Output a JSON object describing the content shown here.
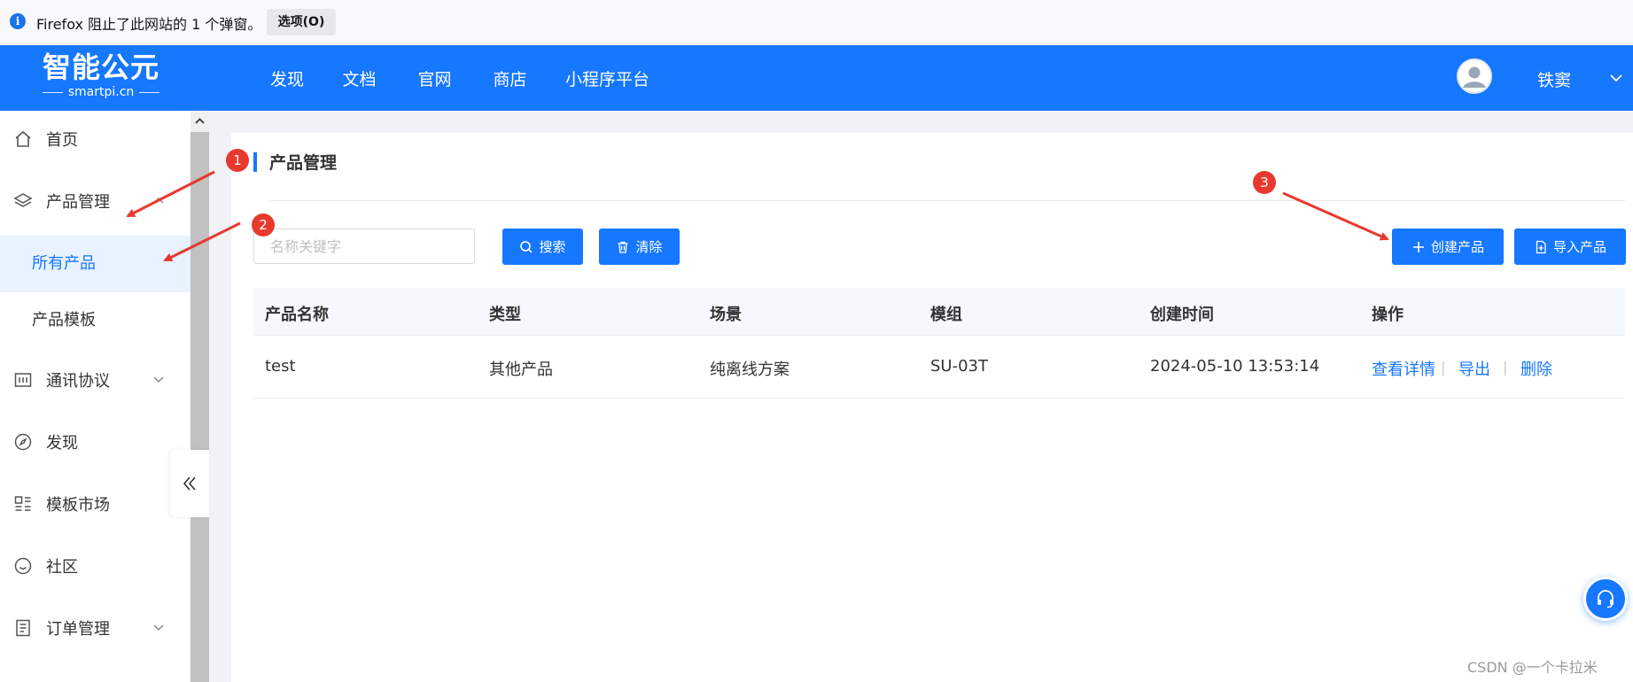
{
  "browser_notice": {
    "icon": "info-icon",
    "text": "Firefox 阻止了此网站的 1 个弹窗。",
    "options_button": "选项(O)"
  },
  "header": {
    "logo_main": "智能公元",
    "logo_sub": "smartpi.cn",
    "nav": [
      "发现",
      "文档",
      "官网",
      "商店",
      "小程序平台"
    ],
    "username": "铁窦",
    "brand_color": "#1677ff"
  },
  "sidebar": {
    "items": [
      {
        "label": "首页",
        "icon": "home-icon"
      },
      {
        "label": "产品管理",
        "icon": "layers-icon",
        "expanded": true
      },
      {
        "label": "所有产品",
        "sub": true,
        "active": true
      },
      {
        "label": "产品模板",
        "sub": true
      },
      {
        "label": "通讯协议",
        "icon": "protocol-icon"
      },
      {
        "label": "发现",
        "icon": "compass-icon"
      },
      {
        "label": "模板市场",
        "icon": "template-icon"
      },
      {
        "label": "社区",
        "icon": "smile-icon"
      },
      {
        "label": "订单管理",
        "icon": "order-icon"
      }
    ]
  },
  "page": {
    "title": "产品管理",
    "search_placeholder": "名称关键字",
    "search_button": "搜索",
    "clear_button": "清除",
    "create_button": "创建产品",
    "import_button": "导入产品"
  },
  "table": {
    "columns": [
      "产品名称",
      "类型",
      "场景",
      "模组",
      "创建时间",
      "操作"
    ],
    "rows": [
      {
        "name": "test",
        "type": "其他产品",
        "scene": "纯离线方案",
        "module": "SU-03T",
        "created": "2024-05-10 13:53:14",
        "actions": [
          "查看详情",
          "导出",
          "删除"
        ]
      }
    ],
    "action_separator": "|"
  },
  "annotations": {
    "markers": [
      "1",
      "2",
      "3"
    ],
    "color": "#e8392f"
  },
  "watermark": "CSDN @一个卡拉米"
}
